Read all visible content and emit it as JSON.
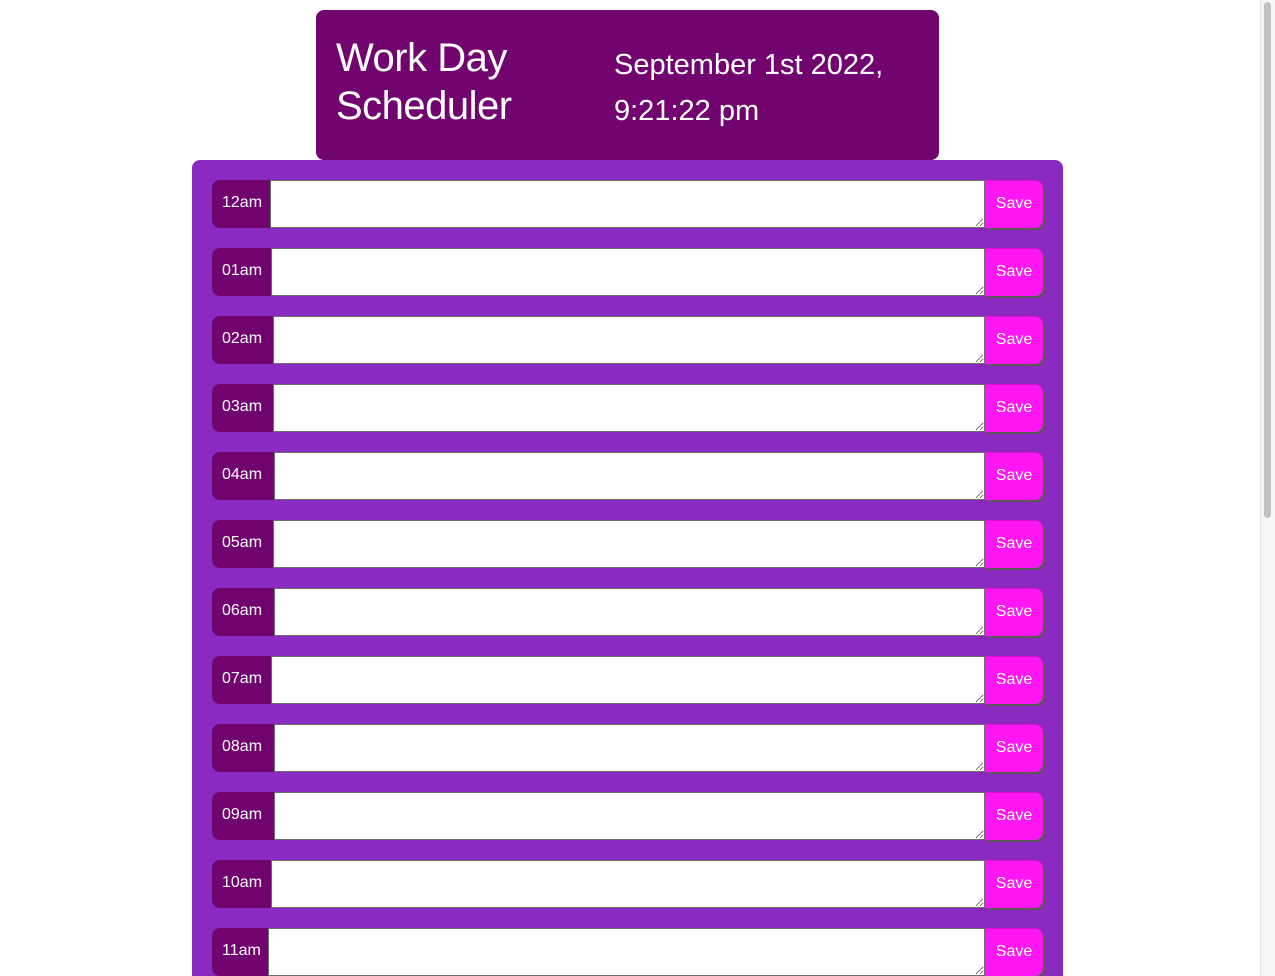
{
  "header": {
    "title": "Work Day Scheduler",
    "current_date": "September 1st 2022, 9:21:22 pm"
  },
  "scheduler": {
    "save_label": "Save",
    "rows": [
      {
        "hour": "12am",
        "task": ""
      },
      {
        "hour": "01am",
        "task": ""
      },
      {
        "hour": "02am",
        "task": ""
      },
      {
        "hour": "03am",
        "task": ""
      },
      {
        "hour": "04am",
        "task": ""
      },
      {
        "hour": "05am",
        "task": ""
      },
      {
        "hour": "06am",
        "task": ""
      },
      {
        "hour": "07am",
        "task": ""
      },
      {
        "hour": "08am",
        "task": ""
      },
      {
        "hour": "09am",
        "task": ""
      },
      {
        "hour": "10am",
        "task": ""
      },
      {
        "hour": "11am",
        "task": ""
      }
    ]
  },
  "colors": {
    "header_bg": "#72046f",
    "scheduler_bg": "#8a2ac0",
    "hour_bg": "#72046f",
    "save_bg": "#ff16f3"
  }
}
